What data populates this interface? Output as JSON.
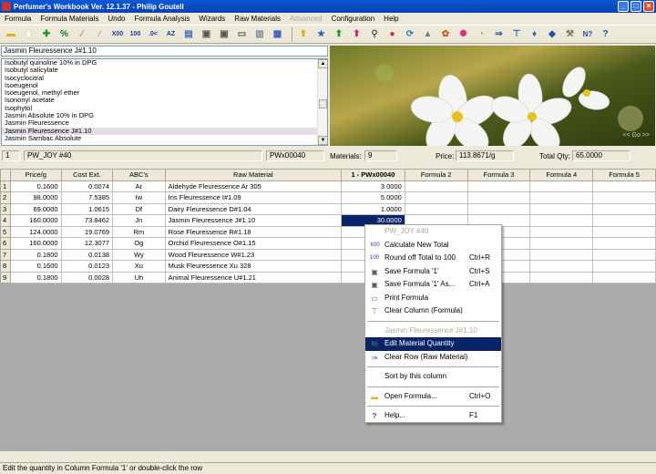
{
  "window": {
    "title": "Perfumer's Workbook Ver. 12.1.37 - Philip Goutell"
  },
  "menu": [
    "Formula",
    "Formula Materials",
    "Undo",
    "Formula Analysis",
    "Wizards",
    "Raw Materials",
    "Advanced",
    "Configuration",
    "Help"
  ],
  "search": {
    "value": "Jasmin Fleuressence J#1.10"
  },
  "materials_list": [
    "Isobutyl quinoline 10% in DPG",
    "Isobutyl salicylate",
    "Isocyclocitral",
    "Isoeugenol",
    "Isoeugenol, methyl ether",
    "Isononyl acetate",
    "Isophytol",
    "Jasmin Absolute 10% in DPG",
    "Jasmin Fleuressence",
    "Jasmin Fleuressence J#1.10",
    "Jasmin Sambac Absolute"
  ],
  "photo": {
    "nav": "<<  Go  >>"
  },
  "info": {
    "row": "1",
    "formula_name": "PW_JOY #40",
    "formula_code": "PWx00040",
    "materials_label": "Materials:",
    "materials_value": "9",
    "price_label": "Price:",
    "price_value": "113.8671/g",
    "qty_label": "Total Qty:",
    "qty_value": "65.0000"
  },
  "grid": {
    "headers": [
      "Price/g",
      "Cost Ext.",
      "ABC's",
      "Raw Material",
      "1 - PWx00040",
      "Formula 2",
      "Formula 3",
      "Formula 4",
      "Formula 5"
    ],
    "rows": [
      {
        "n": "1",
        "price": "0.1600",
        "cost": "0.0074",
        "abc": "Ar",
        "material": "Aldehyde Fleuressence Ar 305",
        "f1": "3.0000"
      },
      {
        "n": "2",
        "price": "98.0000",
        "cost": "7.5385",
        "abc": "Iw",
        "material": "Iris Fleuressence I#1.09",
        "f1": "5.0000"
      },
      {
        "n": "3",
        "price": "69.0000",
        "cost": "1.0615",
        "abc": "Df",
        "material": "Dairy Fleuressence D#1.04",
        "f1": "1.0000"
      },
      {
        "n": "4",
        "price": "160.0000",
        "cost": "73.8462",
        "abc": "Jn",
        "material": "Jasmin Fleuressence J#1.10",
        "f1": "30.0000"
      },
      {
        "n": "5",
        "price": "124.0000",
        "cost": "19.0769",
        "abc": "Rm",
        "material": "Rose Fleuressence  R#1.18",
        "f1": ""
      },
      {
        "n": "6",
        "price": "160.0000",
        "cost": "12.3077",
        "abc": "Og",
        "material": "Orchid Fleuressence O#1.15",
        "f1": ""
      },
      {
        "n": "7",
        "price": "0.1800",
        "cost": "0.0138",
        "abc": "Wy",
        "material": "Wood Fleuressence W#1.23",
        "f1": ""
      },
      {
        "n": "8",
        "price": "0.1600",
        "cost": "0.0123",
        "abc": "Xu",
        "material": "Musk Fleuressence Xu 328",
        "f1": ""
      },
      {
        "n": "9",
        "price": "0.1800",
        "cost": "0.0028",
        "abc": "Uh",
        "material": "Animal Fleuressence U#1.21",
        "f1": ""
      }
    ]
  },
  "context_menu": {
    "header1": "PW_JOY #40",
    "calc": "Calculate New Total",
    "round": "Round off Total to 100",
    "round_sc": "Ctrl+R",
    "save": "Save Formula '1'",
    "save_sc": "Ctrl+S",
    "saveas": "Save Formula '1' As...",
    "saveas_sc": "Ctrl+A",
    "print": "Print Formula",
    "clearcol": "Clear Column (Formula)",
    "header2": "Jasmin Fleuressence J#1.10",
    "edit": "Edit Material Quantity",
    "clearrow": "Clear Row (Raw Material)",
    "sort": "Sort by this column",
    "open": "Open Formula...",
    "open_sc": "Ctrl+O",
    "help": "Help...",
    "help_sc": "F1"
  },
  "status": "Edit the quantity in Column Formula '1' or double-click the row"
}
